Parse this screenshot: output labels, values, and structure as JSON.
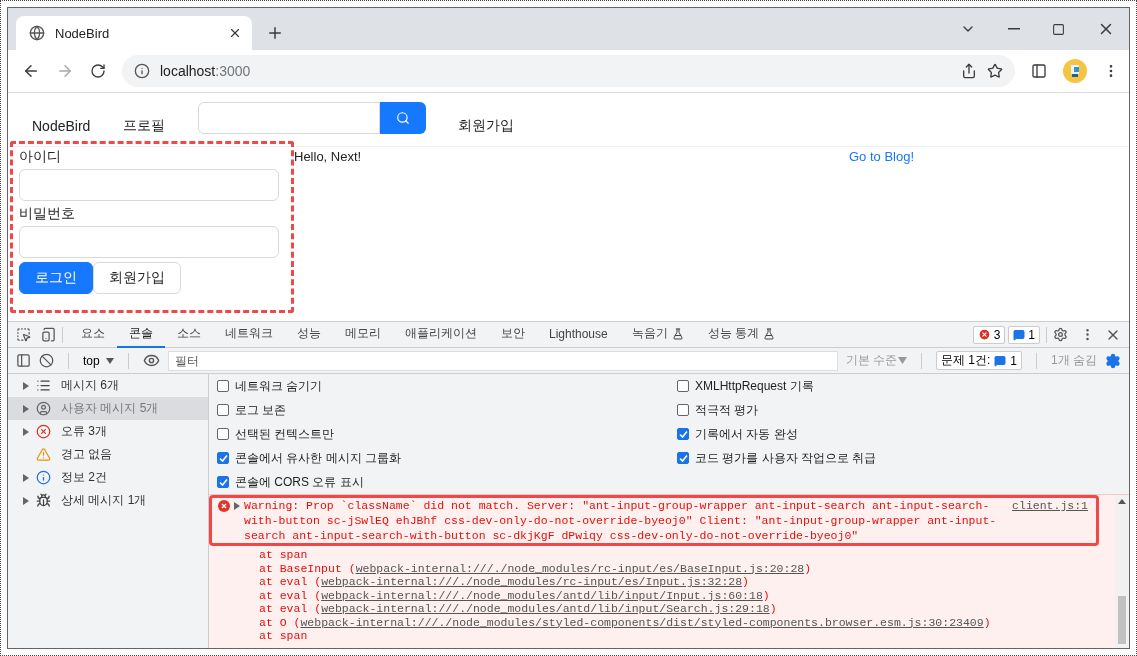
{
  "browser": {
    "tab_title": "NodeBird",
    "url_host": "localhost",
    "url_port": ":3000"
  },
  "page": {
    "nav_items": [
      "NodeBird",
      "프로필"
    ],
    "signup_link": "회원가입",
    "login_form": {
      "id_label": "아이디",
      "password_label": "비밀번호",
      "login_button": "로그인",
      "signup_button": "회원가입"
    },
    "greeting": "Hello, Next!",
    "blog_link": "Go to Blog!"
  },
  "devtools": {
    "tabs": [
      {
        "label": "요소",
        "selected": false,
        "experimental": false
      },
      {
        "label": "콘솔",
        "selected": true,
        "experimental": false
      },
      {
        "label": "소스",
        "selected": false,
        "experimental": false
      },
      {
        "label": "네트워크",
        "selected": false,
        "experimental": false
      },
      {
        "label": "성능",
        "selected": false,
        "experimental": false
      },
      {
        "label": "메모리",
        "selected": false,
        "experimental": false
      },
      {
        "label": "애플리케이션",
        "selected": false,
        "experimental": false
      },
      {
        "label": "보안",
        "selected": false,
        "experimental": false
      },
      {
        "label": "Lighthouse",
        "selected": false,
        "experimental": false
      },
      {
        "label": "녹음기",
        "selected": false,
        "experimental": true
      },
      {
        "label": "성능 통계",
        "selected": false,
        "experimental": true
      }
    ],
    "error_count": "3",
    "message_count": "1",
    "context": "top",
    "filter_placeholder": "필터",
    "level_filter": "기본 수준",
    "issues_label": "문제 1건:",
    "issues_count": "1",
    "hidden_count": "1개 숨김",
    "sidebar": [
      {
        "kind": "list",
        "label": "메시지 6개",
        "expandable": true,
        "selected": false
      },
      {
        "kind": "user",
        "label": "사용자 메시지 5개",
        "expandable": true,
        "selected": true
      },
      {
        "kind": "error",
        "label": "오류 3개",
        "expandable": true,
        "selected": false
      },
      {
        "kind": "warning",
        "label": "경고 없음",
        "expandable": false,
        "selected": false
      },
      {
        "kind": "info",
        "label": "정보 2건",
        "expandable": true,
        "selected": false
      },
      {
        "kind": "verbose",
        "label": "상세 메시지 1개",
        "expandable": true,
        "selected": false
      }
    ],
    "settings_left": [
      {
        "label": "네트워크 숨기기",
        "checked": false
      },
      {
        "label": "로그 보존",
        "checked": false
      },
      {
        "label": "선택된 컨텍스트만",
        "checked": false
      },
      {
        "label": "콘솔에서 유사한 메시지 그룹화",
        "checked": true
      },
      {
        "label": "콘솔에 CORS 오류 표시",
        "checked": true
      }
    ],
    "settings_right": [
      {
        "label": "XMLHttpRequest 기록",
        "checked": false
      },
      {
        "label": "적극적 평가",
        "checked": false
      },
      {
        "label": "기록에서 자동 완성",
        "checked": true
      },
      {
        "label": "코드 평가를 사용자 작업으로 취급",
        "checked": true
      }
    ],
    "messages": [
      {
        "kind": "error",
        "text": "Warning: Prop `className` did not match. Server: \"ant-input-group-wrapper ant-input-search ant-input-search-with-button sc-jSwlEQ ehJBhf css-dev-only-do-not-override-byeoj0\" Client: \"ant-input-group-wrapper ant-input-search ant-input-search-with-button sc-dkjKgF dPwiqy css-dev-only-do-not-override-byeoj0\"",
        "source": "client.js:1",
        "stack": [
          {
            "prefix": "at span"
          },
          {
            "prefix": "at BaseInput (",
            "link": "webpack-internal:///./node_modules/rc-input/es/BaseInput.js:20:28",
            "suffix": ")"
          },
          {
            "prefix": "at eval (",
            "link": "webpack-internal:///./node_modules/rc-input/es/Input.js:32:28",
            "suffix": ")"
          },
          {
            "prefix": "at eval (",
            "link": "webpack-internal:///./node_modules/antd/lib/input/Input.js:60:18",
            "suffix": ")"
          },
          {
            "prefix": "at eval (",
            "link": "webpack-internal:///./node_modules/antd/lib/input/Search.js:29:18",
            "suffix": ")"
          },
          {
            "prefix": "at O (",
            "link": "webpack-internal:///./node_modules/styled-components/dist/styled-components.browser.esm.js:30:23409",
            "suffix": ")"
          },
          {
            "prefix": "at span"
          }
        ]
      }
    ]
  }
}
